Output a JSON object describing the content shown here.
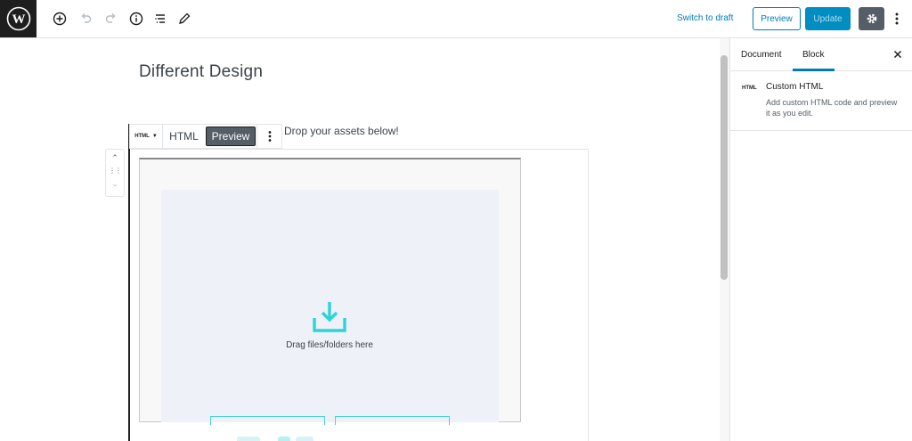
{
  "toolbar": {
    "switch_to_draft": "Switch to draft",
    "preview_label": "Preview",
    "update_label": "Update",
    "icons": [
      "wordpress-logo",
      "add-block-icon",
      "undo-icon",
      "redo-icon",
      "info-icon",
      "outline-icon",
      "edit-icon",
      "gear-icon",
      "more-vertical-icon"
    ]
  },
  "editor": {
    "post_title": "Different Design",
    "block_toolbar": {
      "switcher_label": "HTML",
      "html_tab": "HTML",
      "preview_tab": "Preview"
    },
    "block_hint": "Drop your assets below!",
    "dropzone": {
      "text": "Drag files/folders here",
      "accent": "#2bd4d9"
    }
  },
  "sidebar": {
    "tabs": [
      "Document",
      "Block"
    ],
    "active_tab": "Block",
    "block": {
      "icon_label": "HTML",
      "title": "Custom HTML",
      "description": "Add custom HTML code and preview it as you edit."
    }
  },
  "colors": {
    "accent": "#007cba",
    "update_bg": "#008ec2",
    "dark": "#1e1e1e"
  }
}
